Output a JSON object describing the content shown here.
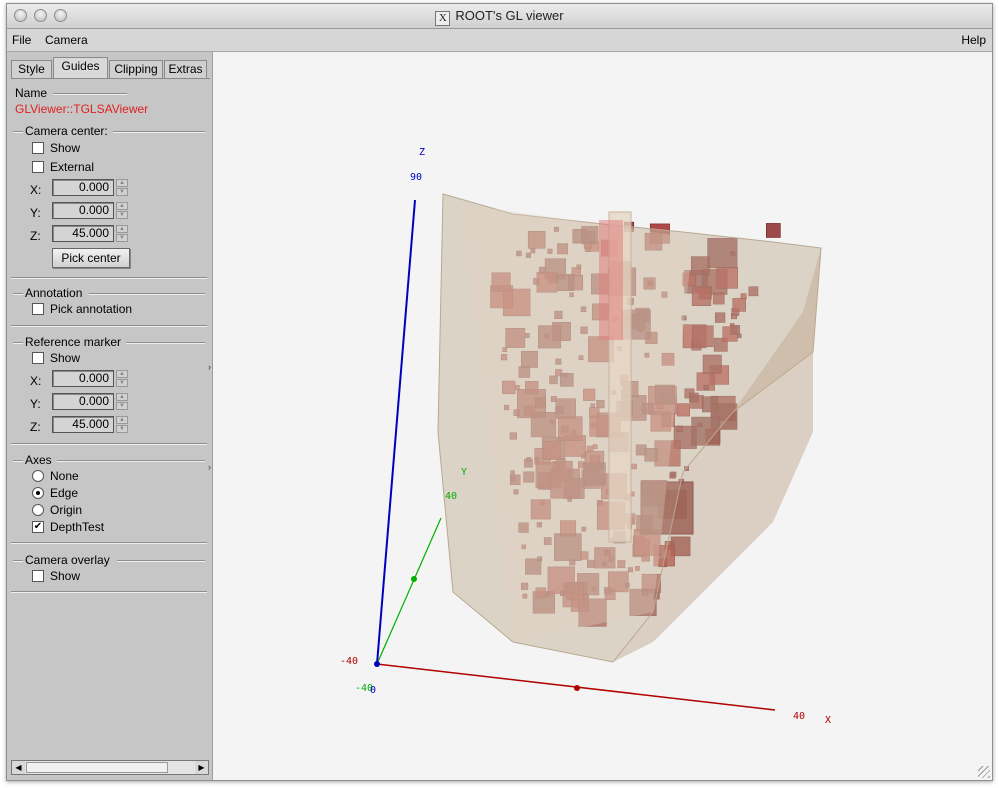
{
  "window": {
    "title": "ROOT's GL viewer",
    "title_icon": "x11-logo-icon"
  },
  "menu": {
    "file": "File",
    "camera": "Camera",
    "help": "Help"
  },
  "tabs": [
    "Style",
    "Guides",
    "Clipping",
    "Extras"
  ],
  "active_tab": "Guides",
  "panel": {
    "name_label": "Name",
    "name_value": "GLViewer::TGLSAViewer",
    "camera_center": {
      "title": "Camera center:",
      "show_label": "Show",
      "show_checked": false,
      "external_label": "External",
      "external_checked": false,
      "x_label": "X:",
      "x_value": "0.000",
      "y_label": "Y:",
      "y_value": "0.000",
      "z_label": "Z:",
      "z_value": "45.000",
      "pick_button": "Pick center"
    },
    "annotation": {
      "title": "Annotation",
      "pick_label": "Pick annotation",
      "pick_checked": false
    },
    "reference_marker": {
      "title": "Reference marker",
      "show_label": "Show",
      "show_checked": false,
      "x_label": "X:",
      "x_value": "0.000",
      "y_label": "Y:",
      "y_value": "0.000",
      "z_label": "Z:",
      "z_value": "45.000"
    },
    "axes": {
      "title": "Axes",
      "options": [
        "None",
        "Edge",
        "Origin"
      ],
      "selected": "Edge",
      "depth_test_label": "DepthTest",
      "depth_test_checked": true
    },
    "camera_overlay": {
      "title": "Camera overlay",
      "show_label": "Show",
      "show_checked": false
    }
  },
  "axis_labels": {
    "z_name": "Z",
    "z_max": "90",
    "y_name": "Y",
    "y_max": "40",
    "x_name": "X",
    "x_max": "40",
    "origin_x": "-40",
    "origin_y": "-40",
    "origin_z": "0"
  },
  "colors": {
    "x_axis": "#b00000",
    "y_axis": "#00b000",
    "z_axis": "#0000c0",
    "name_text": "#e02020"
  }
}
